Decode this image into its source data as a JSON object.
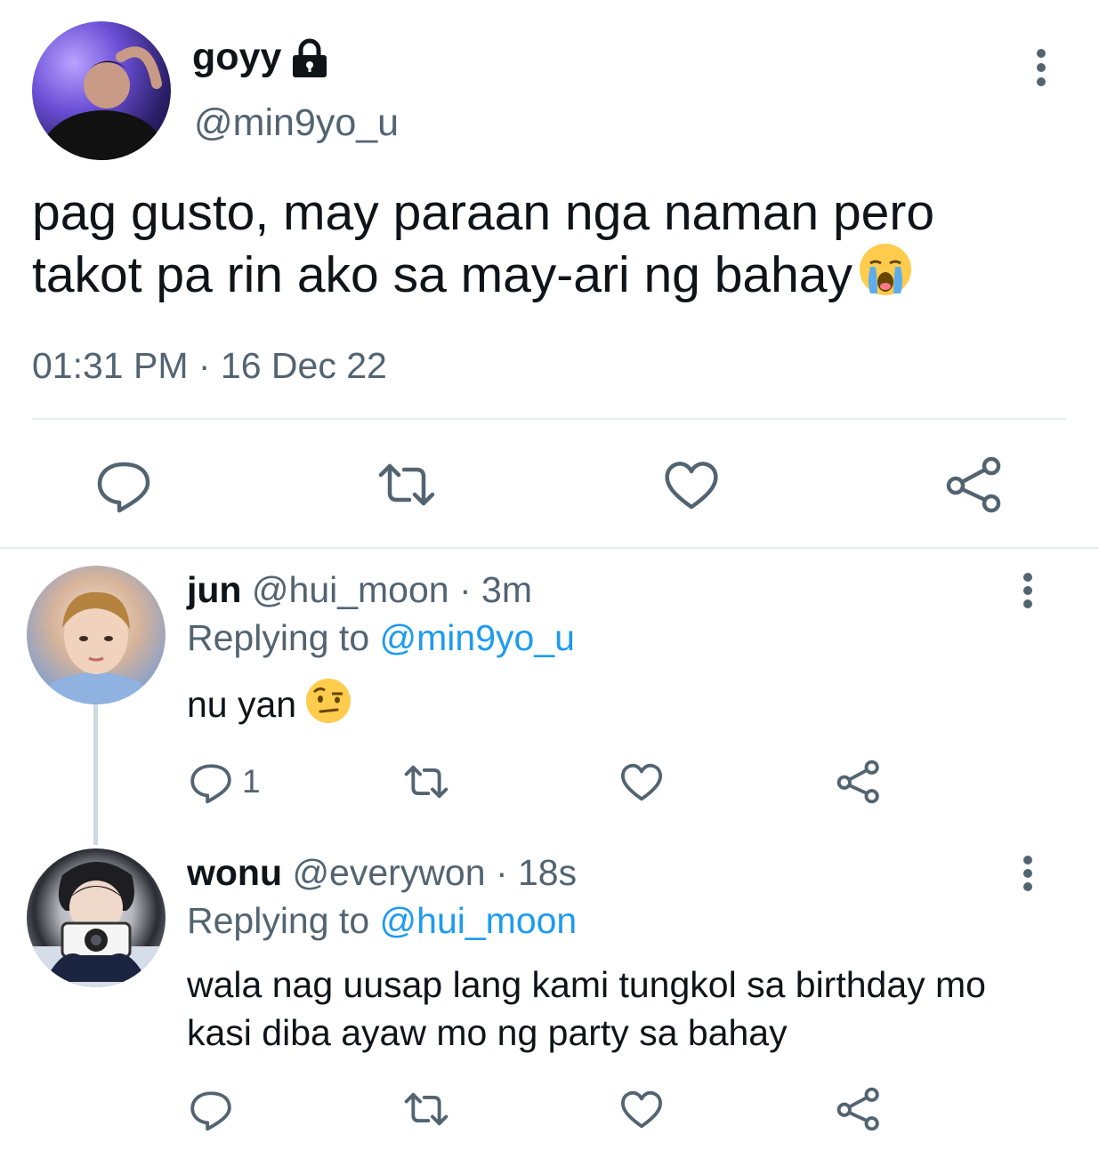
{
  "main_tweet": {
    "display_name": "goyy",
    "handle": "@min9yo_u",
    "text": "pag gusto, may paraan nga naman pero takot pa rin ako sa may-ari ng bahay",
    "emoji": "loudly-crying-face",
    "timestamp": "01:31 PM · 16 Dec 22"
  },
  "replies": [
    {
      "display_name": "jun",
      "handle": "@hui_moon",
      "time": "· 3m",
      "replying_prefix": "Replying to",
      "replying_to": "@min9yo_u",
      "text": "nu yan",
      "emoji": "face-with-raised-eyebrow",
      "reply_count": "1"
    },
    {
      "display_name": "wonu",
      "handle": "@everywon",
      "time": "· 18s",
      "replying_prefix": "Replying to",
      "replying_to": "@hui_moon",
      "text": "wala nag uusap lang kami tungkol sa birthday mo kasi diba ayaw mo ng party sa bahay"
    }
  ],
  "colors": {
    "text": "#0f1419",
    "secondary": "#536471",
    "link": "#1d9bf0",
    "divider": "#e6ecf0"
  }
}
